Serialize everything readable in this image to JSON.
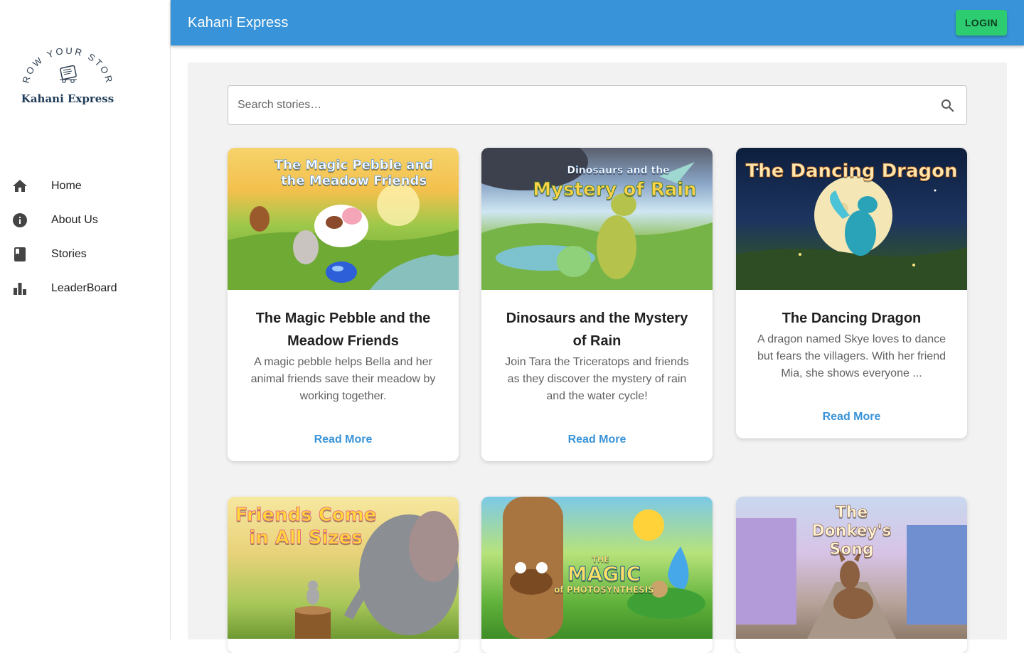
{
  "brand": {
    "logo_arc_text": "GROW YOUR STORY",
    "logo_name": "Kahani Express",
    "app_title": "Kahani Express"
  },
  "header": {
    "login_label": "LOGIN"
  },
  "sidebar": {
    "items": [
      {
        "label": "Home",
        "icon": "home-icon"
      },
      {
        "label": "About Us",
        "icon": "info-icon"
      },
      {
        "label": "Stories",
        "icon": "book-icon"
      },
      {
        "label": "LeaderBoard",
        "icon": "leaderboard-icon"
      }
    ]
  },
  "search": {
    "placeholder": "Search stories…"
  },
  "stories": [
    {
      "title": "The Magic Pebble and the Meadow Friends",
      "description": "A magic pebble helps Bella and her animal friends save their meadow by working together.",
      "link": "Read More",
      "cover_text": "The Magic Pebble and the Meadow Friends"
    },
    {
      "title": "Dinosaurs and the Mystery of Rain",
      "description": "Join Tara the Triceratops and friends as they discover the mystery of rain and the water cycle!",
      "link": "Read More",
      "cover_text_top": "Dinosaurs and the",
      "cover_text_main": "Mystery of Rain"
    },
    {
      "title": "The Dancing Dragon",
      "description": "A dragon named Skye loves to dance but fears the villagers. With her friend Mia, she shows everyone ...",
      "link": "Read More",
      "cover_text": "The Dancing Dragon"
    },
    {
      "cover_text": "Friends Come in All Sizes"
    },
    {
      "cover_text_top": "THE",
      "cover_text_main": "MAGIC",
      "cover_text_sub": "of PHOTOSYNTHESIS"
    },
    {
      "cover_text": "The Donkey's Song"
    }
  ],
  "colors": {
    "appbar": "#3893d8",
    "login_button": "#2ecc71",
    "read_more": "#3893d8",
    "panel_bg": "#f2f2f2"
  }
}
